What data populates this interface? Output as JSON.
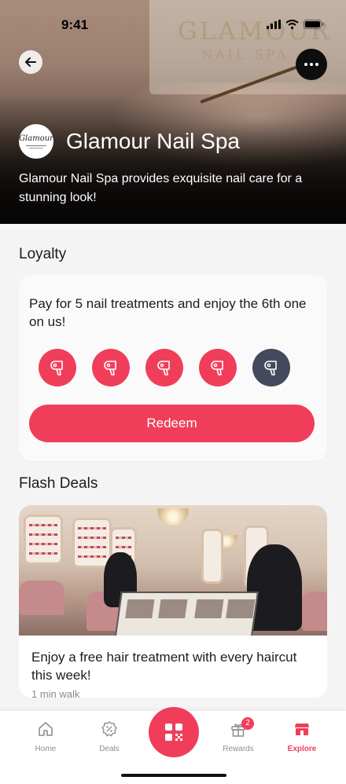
{
  "status_bar": {
    "time": "9:41"
  },
  "header": {
    "sign_line1": "GLAMOUR",
    "sign_line2": "NAIL SPA",
    "logo_text": "Glamour",
    "title": "Glamour Nail Spa",
    "description": "Glamour Nail Spa provides exquisite nail care for a stunning look!",
    "icons": {
      "back": "arrow-left-icon",
      "more": "more-horizontal-icon"
    }
  },
  "loyalty": {
    "section_title": "Loyalty",
    "text": "Pay for 5 nail treatments and enjoy the 6th one on us!",
    "stamps_collected": 4,
    "stamps_total": 5,
    "stamp_icon": "hair-dryer-icon",
    "redeem_label": "Redeem",
    "colors": {
      "active": "#f03e5a",
      "inactive": "#434a5c"
    }
  },
  "flash_deals": {
    "section_title": "Flash Deals",
    "deal": {
      "text": "Enjoy a free hair treatment with every haircut this week!",
      "meta": "1 min walk"
    }
  },
  "bottom_nav": {
    "items": [
      {
        "label": "Home",
        "icon": "home-icon"
      },
      {
        "label": "Deals",
        "icon": "discount-badge-icon"
      },
      {
        "label": "",
        "icon": "qr-scan-icon"
      },
      {
        "label": "Rewards",
        "icon": "gift-icon",
        "badge": "2"
      },
      {
        "label": "Explore",
        "icon": "store-icon",
        "active": true
      }
    ]
  },
  "colors": {
    "accent": "#f03e5a",
    "background": "#f4f4f4",
    "card": "#fafafa"
  }
}
